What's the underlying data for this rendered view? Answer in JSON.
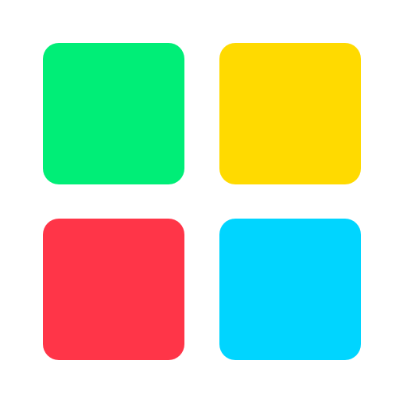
{
  "tiles": [
    {
      "name": "green",
      "color": "#00EE77"
    },
    {
      "name": "yellow",
      "color": "#FFDA00"
    },
    {
      "name": "red",
      "color": "#FF3548"
    },
    {
      "name": "cyan",
      "color": "#00D5FF"
    }
  ]
}
